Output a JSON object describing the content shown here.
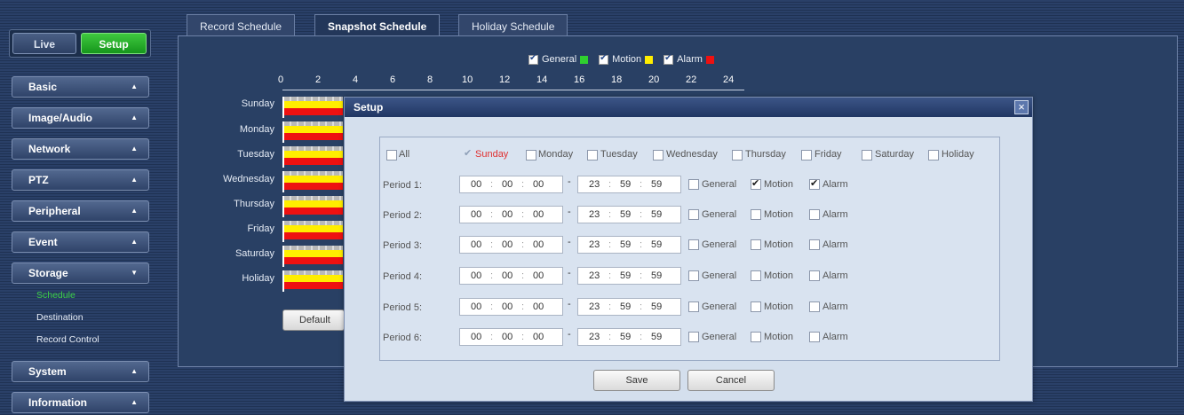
{
  "nav": {
    "live_label": "Live",
    "setup_label": "Setup"
  },
  "menu": {
    "basic": "Basic",
    "image_audio": "Image/Audio",
    "network": "Network",
    "ptz": "PTZ",
    "peripheral": "Peripheral",
    "event": "Event",
    "storage": "Storage",
    "storage_sub": {
      "schedule": "Schedule",
      "destination": "Destination",
      "record_control": "Record Control"
    },
    "system": "System",
    "information": "Information",
    "arrow_up": "▲",
    "arrow_down": "▼"
  },
  "tabs": {
    "record": "Record Schedule",
    "snapshot": "Snapshot Schedule",
    "holiday": "Holiday Schedule"
  },
  "legend": {
    "general": "General",
    "general_color": "#2fd02f",
    "motion": "Motion",
    "motion_color": "#ffee00",
    "alarm": "Alarm",
    "alarm_color": "#ee1111"
  },
  "timeline": {
    "hours": [
      "0",
      "2",
      "4",
      "6",
      "8",
      "10",
      "12",
      "14",
      "16",
      "18",
      "20",
      "22",
      "24"
    ],
    "days": [
      "Sunday",
      "Monday",
      "Tuesday",
      "Wednesday",
      "Thursday",
      "Friday",
      "Saturday",
      "Holiday"
    ]
  },
  "default_label": "Default",
  "dialog": {
    "title": "Setup",
    "close_glyph": "×",
    "all_label": "All",
    "days": [
      "Sunday",
      "Monday",
      "Tuesday",
      "Wednesday",
      "Thursday",
      "Friday",
      "Saturday",
      "Holiday"
    ],
    "periods": {
      "p1": {
        "label": "Period 1:",
        "start": [
          "00",
          "00",
          "00"
        ],
        "end": [
          "23",
          "59",
          "59"
        ],
        "general": false,
        "motion": true,
        "alarm": true
      },
      "p2": {
        "label": "Period 2:",
        "start": [
          "00",
          "00",
          "00"
        ],
        "end": [
          "23",
          "59",
          "59"
        ],
        "general": false,
        "motion": false,
        "alarm": false
      },
      "p3": {
        "label": "Period 3:",
        "start": [
          "00",
          "00",
          "00"
        ],
        "end": [
          "23",
          "59",
          "59"
        ],
        "general": false,
        "motion": false,
        "alarm": false
      },
      "p4": {
        "label": "Period 4:",
        "start": [
          "00",
          "00",
          "00"
        ],
        "end": [
          "23",
          "59",
          "59"
        ],
        "general": false,
        "motion": false,
        "alarm": false
      },
      "p5": {
        "label": "Period 5:",
        "start": [
          "00",
          "00",
          "00"
        ],
        "end": [
          "23",
          "59",
          "59"
        ],
        "general": false,
        "motion": false,
        "alarm": false
      },
      "p6": {
        "label": "Period 6:",
        "start": [
          "00",
          "00",
          "00"
        ],
        "end": [
          "23",
          "59",
          "59"
        ],
        "general": false,
        "motion": false,
        "alarm": false
      }
    },
    "type_labels": {
      "general": "General",
      "motion": "Motion",
      "alarm": "Alarm"
    },
    "save_label": "Save",
    "cancel_label": "Cancel"
  }
}
